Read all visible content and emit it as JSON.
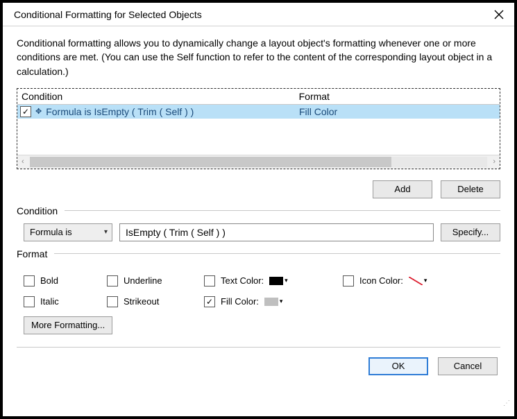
{
  "window": {
    "title": "Conditional Formatting for Selected Objects"
  },
  "intro": "Conditional formatting allows you to dynamically change a layout object's formatting whenever one or more conditions are met. (You can use the Self function to refer to the content of the corresponding layout object in a calculation.)",
  "list": {
    "headers": {
      "condition": "Condition",
      "format": "Format"
    },
    "rows": [
      {
        "checked": true,
        "condition": "Formula is IsEmpty ( Trim ( Self ) )",
        "format": "Fill Color"
      }
    ]
  },
  "buttons": {
    "add": "Add",
    "delete": "Delete",
    "specify": "Specify...",
    "more_formatting": "More Formatting...",
    "ok": "OK",
    "cancel": "Cancel"
  },
  "sections": {
    "condition": "Condition",
    "format": "Format"
  },
  "condition_editor": {
    "type_selected": "Formula is",
    "expression": "IsEmpty ( Trim ( Self ) )"
  },
  "format_options": {
    "bold": {
      "label": "Bold",
      "checked": false
    },
    "italic": {
      "label": "Italic",
      "checked": false
    },
    "underline": {
      "label": "Underline",
      "checked": false
    },
    "strikeout": {
      "label": "Strikeout",
      "checked": false
    },
    "text_color": {
      "label": "Text Color:",
      "checked": false,
      "color": "#000000"
    },
    "fill_color": {
      "label": "Fill Color:",
      "checked": true,
      "color": "#bfbfbf"
    },
    "icon_color": {
      "label": "Icon Color:",
      "checked": false,
      "color": "none"
    }
  }
}
